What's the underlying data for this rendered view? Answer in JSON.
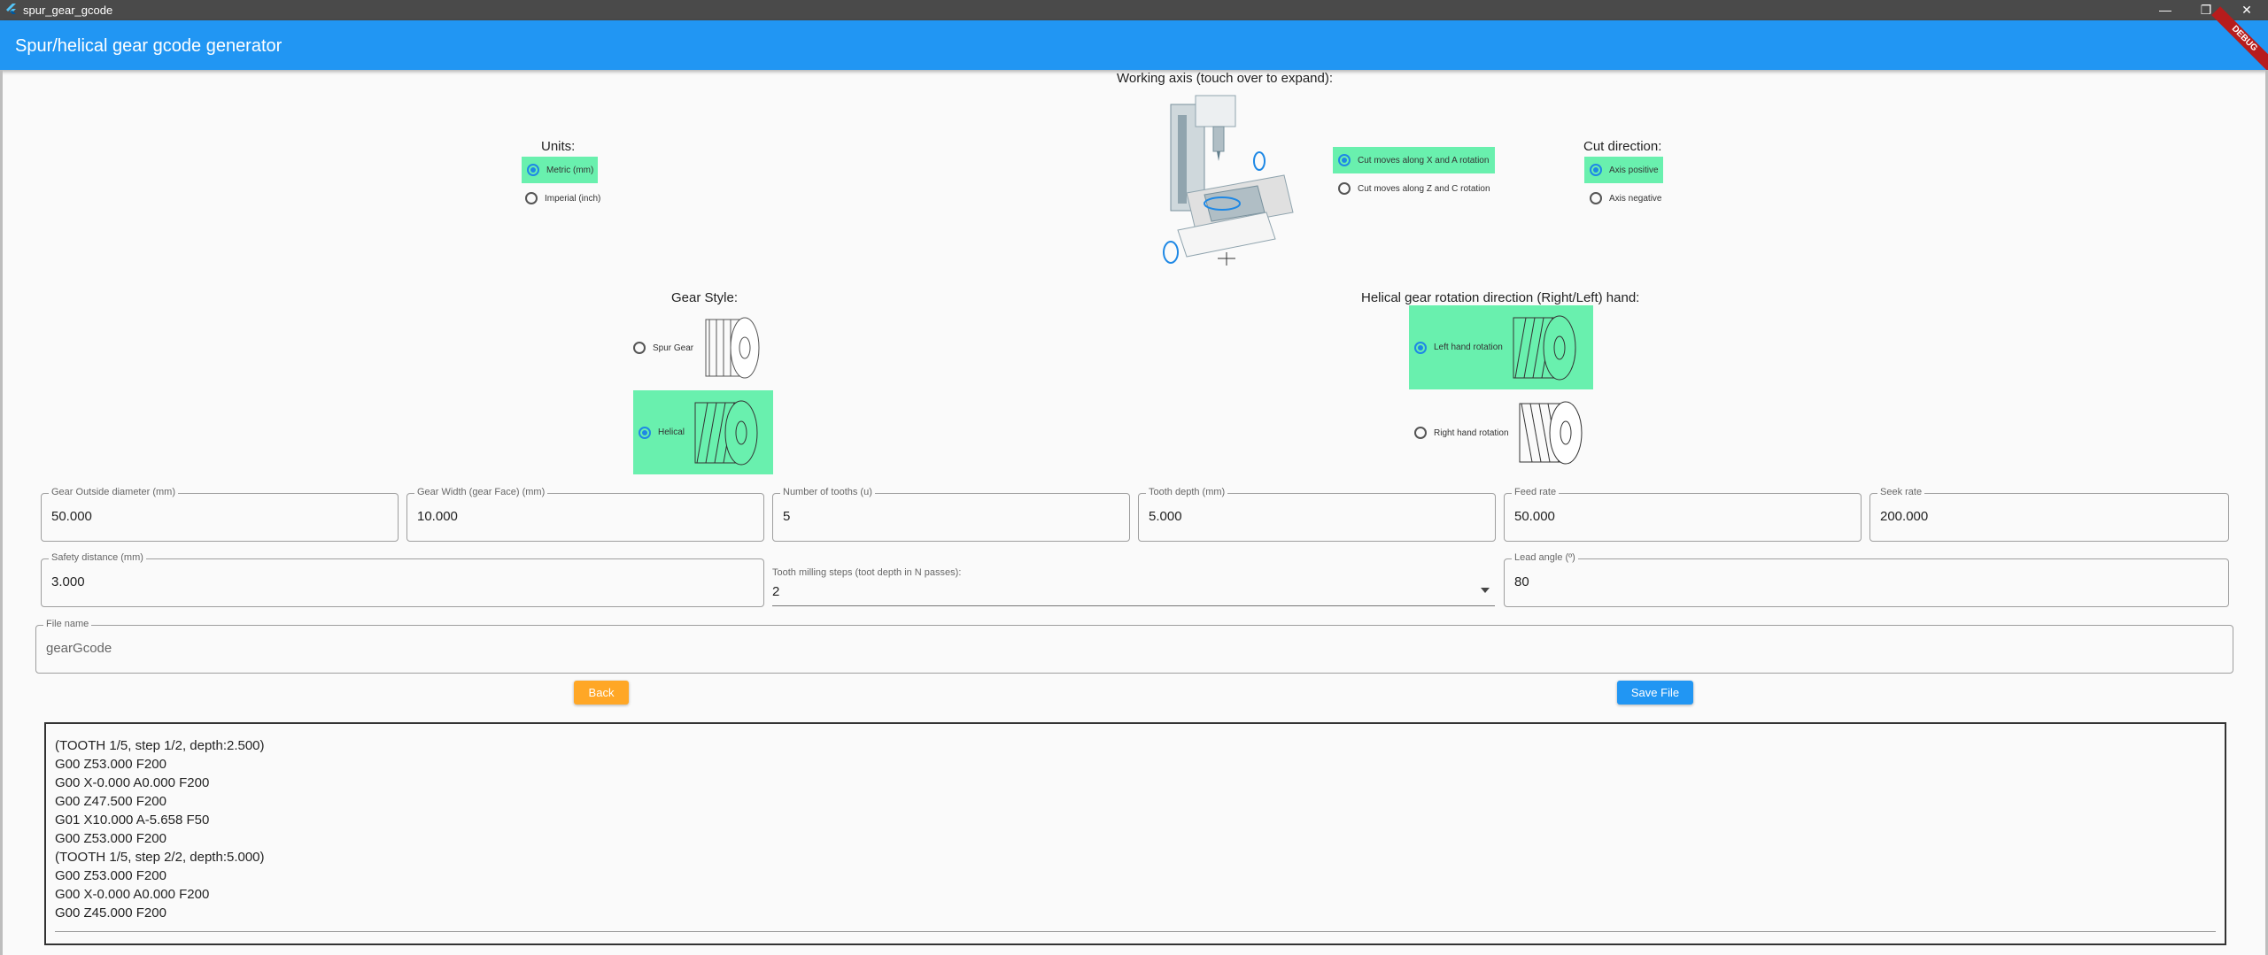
{
  "window": {
    "title": "spur_gear_gcode",
    "minimize": "—",
    "restore": "❐",
    "close": "✕"
  },
  "appbar": {
    "title": "Spur/helical gear gcode generator",
    "debug_banner": "DEBUG"
  },
  "units": {
    "label": "Units:",
    "options": [
      {
        "label": "Metric (mm)",
        "selected": true
      },
      {
        "label": "Imperial (inch)",
        "selected": false
      }
    ]
  },
  "working_axis": {
    "label": "Working axis (touch over to expand):",
    "options": [
      {
        "label": "Cut moves along X and A rotation",
        "selected": true
      },
      {
        "label": "Cut moves along Z and C rotation",
        "selected": false
      }
    ]
  },
  "cut_direction": {
    "label": "Cut direction:",
    "options": [
      {
        "label": "Axis positive",
        "selected": true
      },
      {
        "label": "Axis negative",
        "selected": false
      }
    ]
  },
  "gear_style": {
    "label": "Gear Style:",
    "options": [
      {
        "label": "Spur Gear",
        "selected": false
      },
      {
        "label": "Helical",
        "selected": true
      }
    ]
  },
  "helical_direction": {
    "label": "Helical gear rotation direction (Right/Left) hand:",
    "options": [
      {
        "label": "Left hand rotation",
        "selected": true
      },
      {
        "label": "Right hand rotation",
        "selected": false
      }
    ]
  },
  "fields": {
    "outside_diameter": {
      "label": "Gear Outside diameter (mm)",
      "value": "50.000"
    },
    "gear_width": {
      "label": "Gear Width (gear Face) (mm)",
      "value": "10.000"
    },
    "tooth_count": {
      "label": "Number of tooths (u)",
      "value": "5"
    },
    "tooth_depth": {
      "label": "Tooth depth (mm)",
      "value": "5.000"
    },
    "feed_rate": {
      "label": "Feed rate",
      "value": "50.000"
    },
    "seek_rate": {
      "label": "Seek rate",
      "value": "200.000"
    },
    "safety_distance": {
      "label": "Safety distance (mm)",
      "value": "3.000"
    },
    "milling_steps": {
      "label": "Tooth milling steps (toot depth in N passes):",
      "value": "2"
    },
    "lead_angle": {
      "label": "Lead angle (º)",
      "value": "80"
    },
    "file_name": {
      "label": "File name",
      "value": "gearGcode"
    }
  },
  "buttons": {
    "back": "Back",
    "save": "Save File"
  },
  "colors": {
    "accent": "#2196f3",
    "selected": "#69f0ae",
    "back_button": "#ffa726",
    "save_button": "#2196f3"
  },
  "output_lines": [
    "(TOOTH 1/5, step 1/2, depth:2.500)",
    "G00 Z53.000 F200",
    "G00 X-0.000 A0.000 F200",
    "G00 Z47.500 F200",
    "G01 X10.000 A-5.658 F50",
    "G00 Z53.000 F200",
    "(TOOTH 1/5, step 2/2, depth:5.000)",
    "G00 Z53.000 F200",
    "G00 X-0.000 A0.000 F200",
    "G00 Z45.000 F200"
  ]
}
